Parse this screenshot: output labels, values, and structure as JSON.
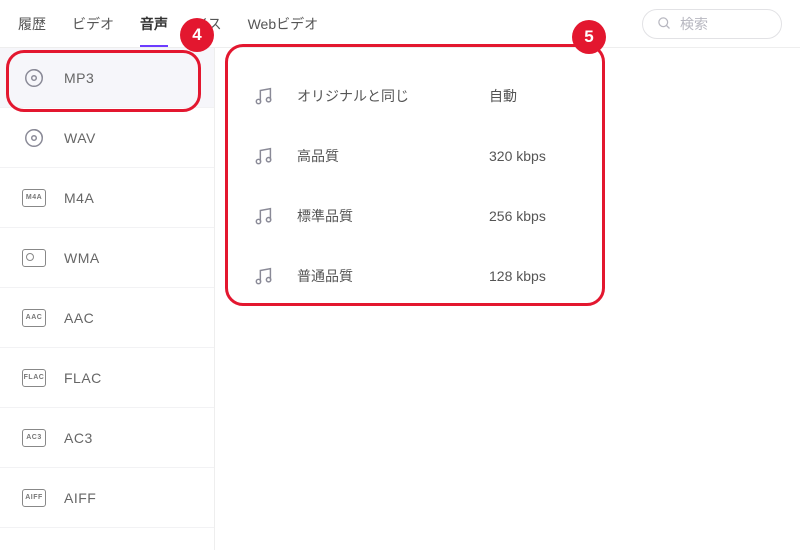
{
  "tabs": {
    "history": "履歴",
    "video": "ビデオ",
    "audio": "音声",
    "device": "イス",
    "web": "Webビデオ"
  },
  "search": {
    "placeholder": "検索"
  },
  "formats": {
    "mp3": "MP3",
    "wav": "WAV",
    "m4a": "M4A",
    "wma": "WMA",
    "aac": "AAC",
    "flac": "FLAC",
    "ac3": "AC3",
    "aiff": "AIFF"
  },
  "quality": {
    "original": {
      "name": "オリジナルと同じ",
      "rate": "自動"
    },
    "high": {
      "name": "高品質",
      "rate": "320 kbps"
    },
    "standard": {
      "name": "標準品質",
      "rate": "256 kbps"
    },
    "normal": {
      "name": "普通品質",
      "rate": "128 kbps"
    }
  },
  "callouts": {
    "c4": "4",
    "c5": "5"
  }
}
